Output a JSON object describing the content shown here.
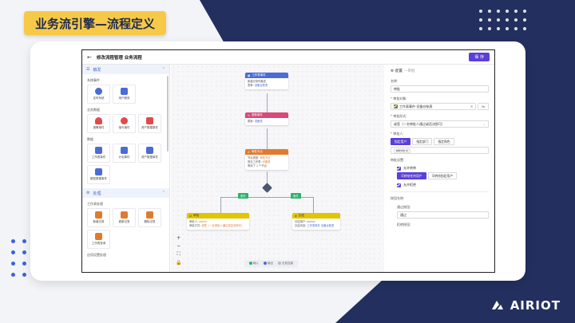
{
  "slide": {
    "title": "业务流引擎—流程定义",
    "logo_text": "AIRIOT",
    "colors": {
      "navy": "#23305f",
      "badge": "#f7c948",
      "accent": "#5b3fd6"
    }
  },
  "app": {
    "header": {
      "title": "修改流程管理 业务流程",
      "save_label": "保 存"
    },
    "left_panel": {
      "header_label": "触发",
      "sections": [
        {
          "title": "系统事件",
          "items": [
            {
              "label": "定时系统",
              "color": "#4a6cd4"
            },
            {
              "label": "用户服务",
              "color": "#4a6cd4"
            }
          ]
        },
        {
          "title": "业务数据",
          "items": [
            {
              "label": "报警事件",
              "color": "#e24a4a"
            },
            {
              "label": "指令事件",
              "color": "#e24a4a"
            },
            {
              "label": "资产数据事件",
              "color": "#e24a4a"
            }
          ]
        },
        {
          "title": "数据",
          "items": [
            {
              "label": "工作表事件",
              "color": "#4a6cd4"
            },
            {
              "label": "计划事件",
              "color": "#4a6cd4"
            },
            {
              "label": "资产数据事件",
              "color": "#4a6cd4"
            },
            {
              "label": "模型数据事件",
              "color": "#4a6cd4"
            }
          ]
        }
      ],
      "process_header": "处理",
      "process_sections": [
        {
          "title": "工作表处理",
          "items": [
            {
              "label": "新增记录",
              "color": "#e07b2e"
            },
            {
              "label": "更新记录",
              "color": "#e07b2e"
            },
            {
              "label": "删除记录",
              "color": "#e07b2e"
            },
            {
              "label": "工作表查询",
              "color": "#e07b2e"
            }
          ]
        }
      ],
      "bottom_section": "应用设置处理"
    },
    "canvas": {
      "nodes": [
        {
          "id": "n1",
          "title": "工作表事件",
          "color": "#4a6cd4",
          "lines": [
            {
              "k": "新建记录时触发",
              "v": ""
            },
            {
              "k": "表单: ",
              "v": "设备台账表"
            }
          ]
        },
        {
          "id": "n2",
          "title": "更新事件",
          "color": "#d9497a",
          "lines": [
            {
              "k": "更新: ",
              "v": "设备表"
            }
          ]
        },
        {
          "id": "n3",
          "title": "审批节点",
          "color": "#e07b2e",
          "lines": [
            {
              "k": "节点类型: ",
              "v": "审批节点"
            },
            {
              "k": "提交工作表: ",
              "v": "设备表"
            },
            {
              "k": "等待了 1 个节点",
              "v": ""
            }
          ]
        },
        {
          "id": "n4",
          "title": "审批",
          "color": "#e2c400",
          "lines": [
            {
              "k": "审批人: ",
              "v": "admin"
            },
            {
              "k": "审批方式: ",
              "v": "或签（一名审批人通过或否决即可）"
            }
          ]
        },
        {
          "id": "n5",
          "title": "抄送",
          "color": "#e2c400",
          "lines": [
            {
              "k": "抄送用户: ",
              "v": "admin"
            },
            {
              "k": "抄送内容: ",
              "v": "工作表事件 设备台账表"
            }
          ]
        }
      ],
      "branch_tags": [
        "条件",
        "条件"
      ],
      "zoom": {
        "plus": "+",
        "minus": "−",
        "fit": "⛶",
        "lock": "🔒"
      },
      "legend": [
        {
          "label": "输入",
          "color": "#2fb36b"
        },
        {
          "label": "输出",
          "color": "#4a6cd4"
        },
        {
          "label": "无效连接",
          "color": "#bbbbbb"
        }
      ]
    },
    "right_panel": {
      "top_label": "配置",
      "top_sub": "—审批",
      "name_label": "名称:",
      "name_value": "审批",
      "target_label": "审批对象:",
      "target_value": "工作表事件-设备台账表",
      "mode_label": "审批形式:",
      "mode_value": "或签（一名审批人通过或否决即可）",
      "approver_label": "审批人:",
      "approver_tabs": [
        "指定用户",
        "指定部门",
        "指定角色"
      ],
      "approver_chip": "admin",
      "settings_label": "审批设置:",
      "allow_transfer": "允许转审",
      "transfer_buttons": [
        "可转给任何用户",
        "可转给指定用户"
      ],
      "allow_reject": "允许拒绝",
      "button_label": "按钮名称:",
      "pass_label": "通过按钮:",
      "pass_value": "通过",
      "reject_label": "拒绝按钮:"
    }
  }
}
